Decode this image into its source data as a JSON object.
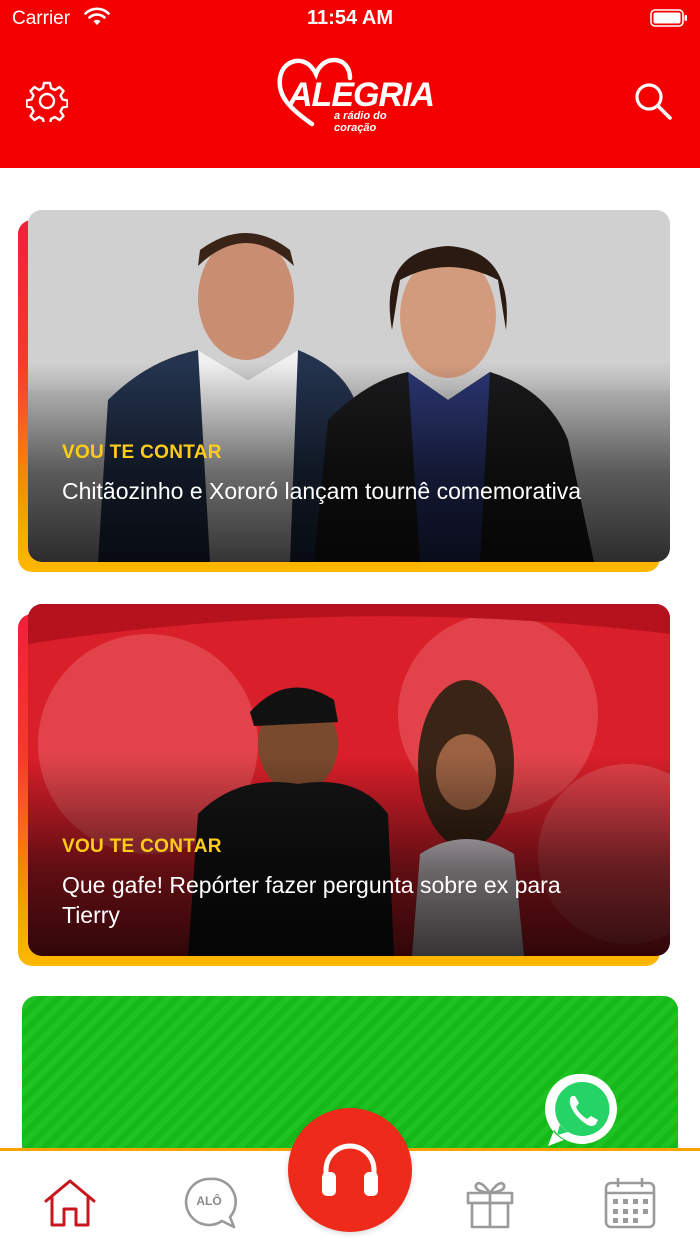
{
  "status_bar": {
    "carrier": "Carrier",
    "time": "11:54 AM"
  },
  "header": {
    "logo_text": "ALEGRIA",
    "logo_subtitle": "a rádio do coração",
    "background_color": "#f50000"
  },
  "feed": {
    "cards": [
      {
        "category": "VOU TE CONTAR",
        "title": "Chitãozinho e Xororó lançam tournê comemorativa"
      },
      {
        "category": "VOU TE CONTAR",
        "title": "Que gafe! Repórter fazer pergunta sobre ex para Tierry"
      }
    ],
    "promo": {
      "icon": "whatsapp-icon",
      "color": "#16b81a"
    }
  },
  "tabbar": {
    "items": [
      {
        "icon": "home-icon",
        "active": true
      },
      {
        "icon": "alo-chat-icon",
        "label": "ALÔ"
      },
      {
        "icon": "headphones-icon"
      },
      {
        "icon": "gift-icon"
      },
      {
        "icon": "calendar-icon"
      }
    ],
    "accent_color": "#ee2a1b"
  }
}
